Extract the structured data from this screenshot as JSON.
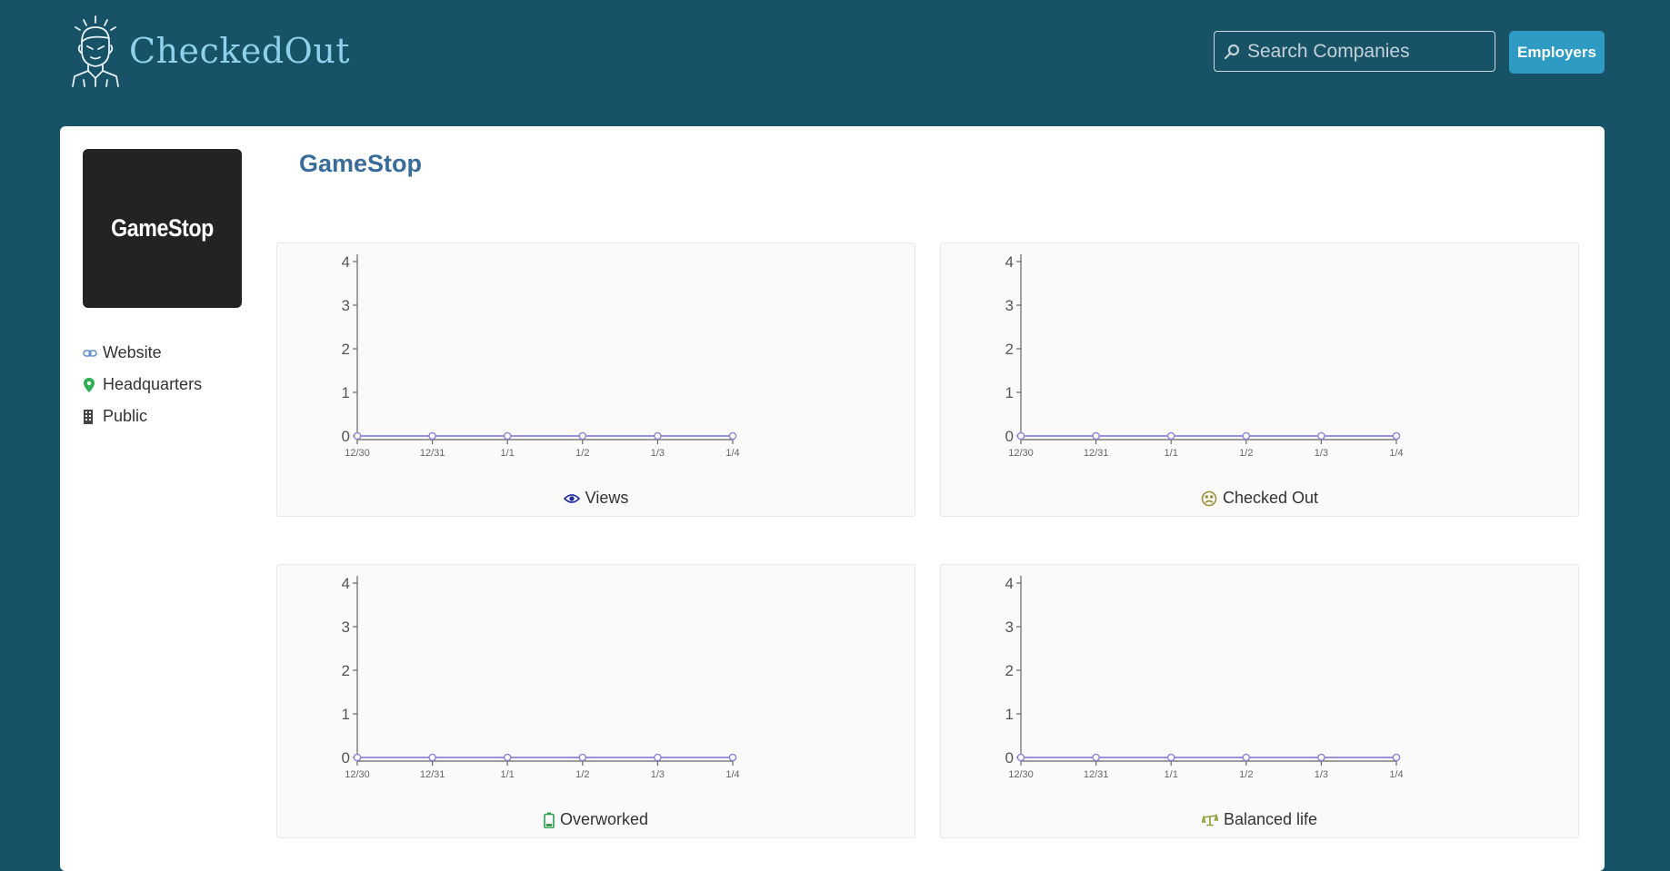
{
  "header": {
    "brand": "CheckedOut",
    "search_placeholder": "Search Companies",
    "employers_label": "Employers"
  },
  "company": {
    "name": "GameStop",
    "logo_text": "GameStop",
    "links": [
      {
        "label": "Website",
        "icon": "link-icon"
      },
      {
        "label": "Headquarters",
        "icon": "map-pin-icon"
      },
      {
        "label": "Public",
        "icon": "building-icon"
      }
    ]
  },
  "charts": [
    {
      "caption": "Views",
      "icon": "eye-icon"
    },
    {
      "caption": "Checked Out",
      "icon": "sad-face-icon"
    },
    {
      "caption": "Overworked",
      "icon": "battery-low-icon"
    },
    {
      "caption": "Balanced life",
      "icon": "scale-icon"
    }
  ],
  "colors": {
    "header_bg": "#185266",
    "brand": "#8fd0ea",
    "button": "#2d9bc4",
    "title": "#3a6c99",
    "line": "#8884d8"
  },
  "chart_data": [
    {
      "type": "line",
      "x": [
        "12/30",
        "12/31",
        "1/1",
        "1/2",
        "1/3",
        "1/4"
      ],
      "values": [
        0,
        0,
        0,
        0,
        0,
        0
      ],
      "yticks": [
        0,
        1,
        2,
        3,
        4
      ],
      "ylim": [
        0,
        4
      ],
      "xlabel": "Views",
      "ylabel": ""
    },
    {
      "type": "line",
      "x": [
        "12/30",
        "12/31",
        "1/1",
        "1/2",
        "1/3",
        "1/4"
      ],
      "values": [
        0,
        0,
        0,
        0,
        0,
        0
      ],
      "yticks": [
        0,
        1,
        2,
        3,
        4
      ],
      "ylim": [
        0,
        4
      ],
      "xlabel": "Checked Out",
      "ylabel": ""
    },
    {
      "type": "line",
      "x": [
        "12/30",
        "12/31",
        "1/1",
        "1/2",
        "1/3",
        "1/4"
      ],
      "values": [
        0,
        0,
        0,
        0,
        0,
        0
      ],
      "yticks": [
        0,
        1,
        2,
        3,
        4
      ],
      "ylim": [
        0,
        4
      ],
      "xlabel": "Overworked",
      "ylabel": ""
    },
    {
      "type": "line",
      "x": [
        "12/30",
        "12/31",
        "1/1",
        "1/2",
        "1/3",
        "1/4"
      ],
      "values": [
        0,
        0,
        0,
        0,
        0,
        0
      ],
      "yticks": [
        0,
        1,
        2,
        3,
        4
      ],
      "ylim": [
        0,
        4
      ],
      "xlabel": "Balanced life",
      "ylabel": ""
    }
  ]
}
